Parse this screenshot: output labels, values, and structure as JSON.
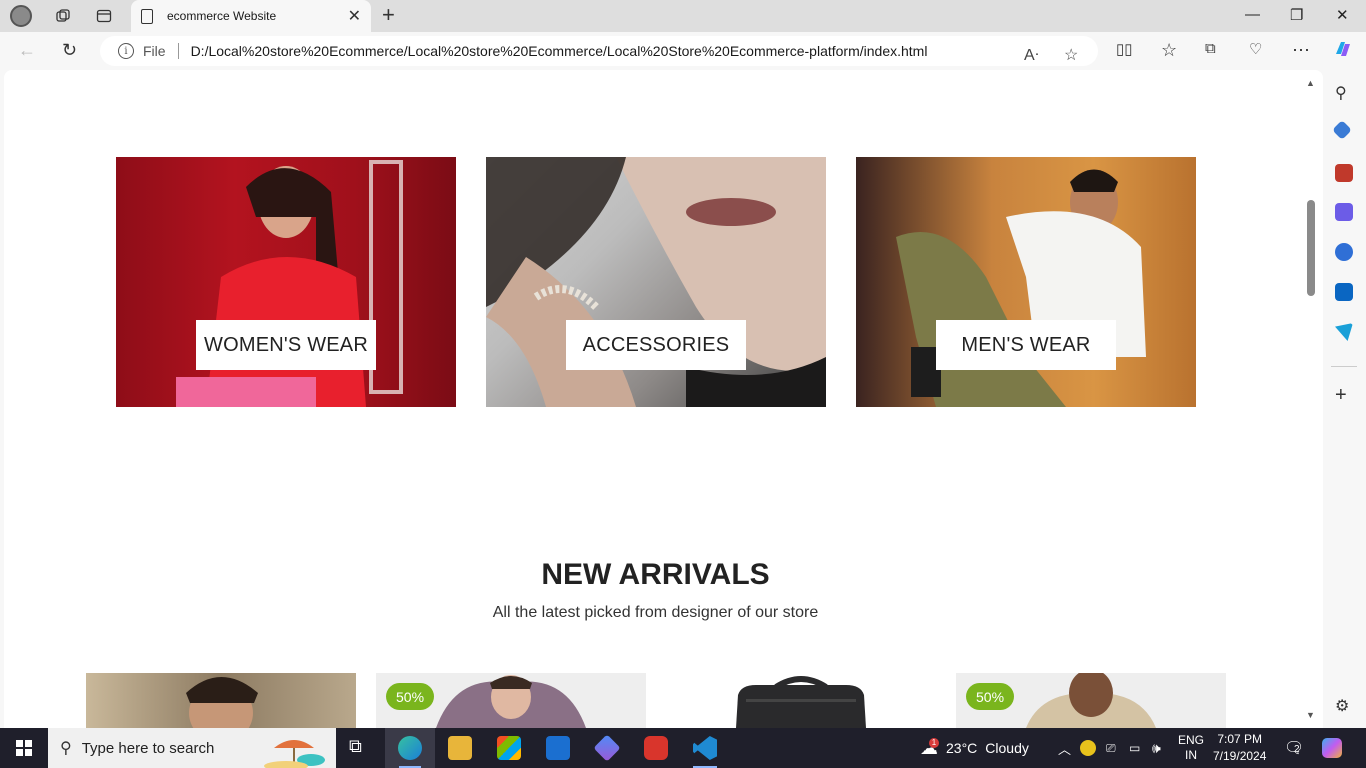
{
  "browser": {
    "tab_title": "ecommerce Website",
    "file_label": "File",
    "url": "D:/Local%20store%20Ecommerce/Local%20store%20Ecommerce/Local%20Store%20Ecommerce-platform/index.html"
  },
  "categories": [
    {
      "label": "WOMEN'S WEAR"
    },
    {
      "label": "ACCESSORIES"
    },
    {
      "label": "MEN'S WEAR"
    }
  ],
  "new_arrivals": {
    "title": "NEW ARRIVALS",
    "subtitle": "All the latest picked from designer of our store",
    "products": [
      {
        "badge": ""
      },
      {
        "badge": "50%"
      },
      {
        "badge": ""
      },
      {
        "badge": "50%"
      }
    ]
  },
  "taskbar": {
    "search_placeholder": "Type here to search",
    "weather_temp": "23°C",
    "weather_text": "Cloudy",
    "lang_top": "ENG",
    "lang_bottom": "IN",
    "time": "7:07 PM",
    "date": "7/19/2024",
    "notifications": "2",
    "weather_badge": "1"
  },
  "colors": {
    "badge": "#7ab51d",
    "taskbar": "#1f1f2b"
  }
}
